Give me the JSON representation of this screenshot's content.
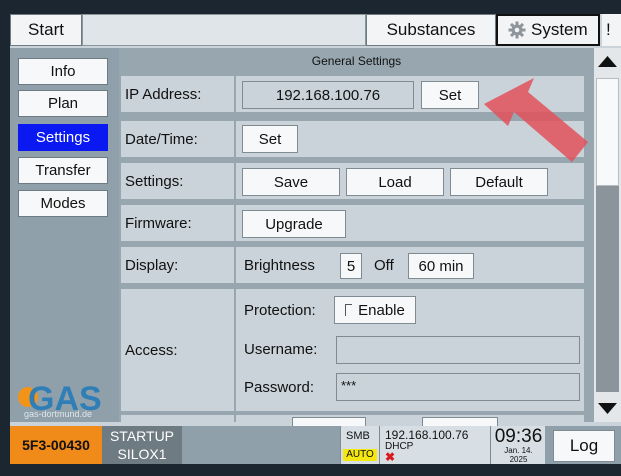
{
  "topbar": {
    "start_label": "Start",
    "substances_label": "Substances",
    "system_label": "System",
    "alert_label": "!"
  },
  "sidebar": {
    "items": [
      {
        "label": "Info"
      },
      {
        "label": "Plan"
      },
      {
        "label": "Settings",
        "active": true
      },
      {
        "label": "Transfer"
      },
      {
        "label": "Modes"
      }
    ],
    "logo_text": "GAS",
    "logo_url": "gas-dortmund.de"
  },
  "panel": {
    "title": "General Settings",
    "ip_label": "IP Address:",
    "ip_value": "192.168.100.76",
    "ip_set": "Set",
    "datetime_label": "Date/Time:",
    "datetime_set": "Set",
    "settings_label": "Settings:",
    "save": "Save",
    "load": "Load",
    "default": "Default",
    "firmware_label": "Firmware:",
    "upgrade": "Upgrade",
    "display_label": "Display:",
    "brightness_label": "Brightness",
    "brightness_value": "5",
    "off_label": "Off",
    "off_value": "60 min",
    "access_label": "Access:",
    "protection_label": "Protection:",
    "enable_label": "Enable",
    "username_label": "Username:",
    "username_value": "",
    "password_label": "Password:",
    "password_value": "***"
  },
  "status": {
    "device_id": "5F3-00430",
    "state": "STARTUP",
    "site": "SILOX1",
    "smb": "SMB",
    "auto": "AUTO",
    "ip": "192.168.100.76",
    "dhcp": "DHCP",
    "time": "09:36",
    "date_line1": "Jan. 14.",
    "date_line2": "2025",
    "log_label": "Log"
  },
  "colors": {
    "active_nav": "#0a19f2",
    "device_id_bg": "#f08a18",
    "arrow": "#e2505a",
    "logo_blue": "#2f7fb6",
    "logo_orange": "#f39419"
  },
  "icons": [
    "gear-icon",
    "scroll-up-icon",
    "scroll-down-icon",
    "checkbox-icon",
    "error-x-icon",
    "arrow-annotation"
  ]
}
